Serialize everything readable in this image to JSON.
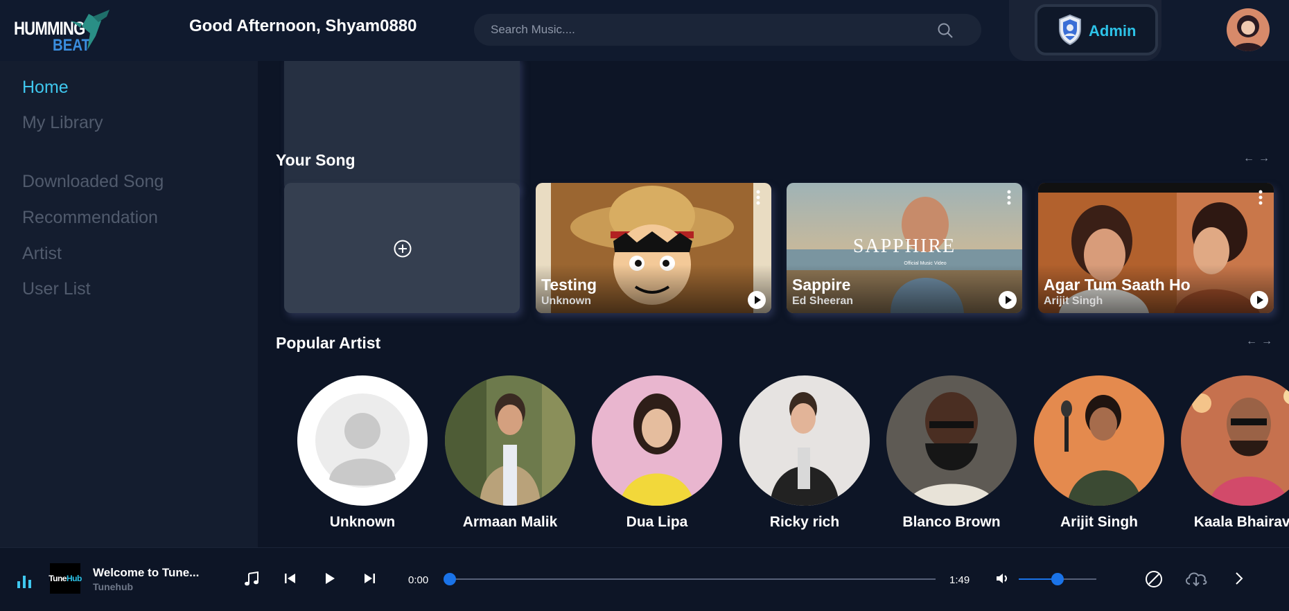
{
  "header": {
    "logo_line1": "HUMMING",
    "logo_line2": "BEAT",
    "greeting": "Good Afternoon, Shyam0880",
    "search_placeholder": "Search Music....",
    "admin_label": "Admin"
  },
  "sidebar": {
    "items": [
      {
        "label": "Home",
        "active": true
      },
      {
        "label": "My Library"
      },
      {
        "label": "Downloaded Song"
      },
      {
        "label": "Recommendation"
      },
      {
        "label": "Artist"
      },
      {
        "label": "User List"
      }
    ]
  },
  "sections": {
    "your_song": "Your Song",
    "popular_artist": "Popular Artist",
    "arrows": "←→"
  },
  "songs": [
    {
      "title": "Testing",
      "artist": "Unknown"
    },
    {
      "title": "Sappire",
      "artist": "Ed Sheeran",
      "art_text": "SAPPHIRE",
      "art_sub": "Official Music Video"
    },
    {
      "title": "Agar Tum Saath Ho",
      "artist": "Arijit Singh"
    }
  ],
  "artists": [
    {
      "name": "Unknown"
    },
    {
      "name": "Armaan Malik"
    },
    {
      "name": "Dua Lipa"
    },
    {
      "name": "Ricky rich"
    },
    {
      "name": "Blanco Brown"
    },
    {
      "name": "Arijit Singh"
    },
    {
      "name": "Kaala Bhairava"
    }
  ],
  "player": {
    "thumb_text1": "Tune",
    "thumb_text2": "Hub",
    "title": "Welcome to Tune...",
    "artist": "Tunehub",
    "current_time": "0:00",
    "duration": "1:49",
    "progress": 0.0,
    "volume": 0.5
  },
  "colors": {
    "accent": "#3fc7ee",
    "slider": "#1a73e8",
    "background": "#0d1526"
  }
}
